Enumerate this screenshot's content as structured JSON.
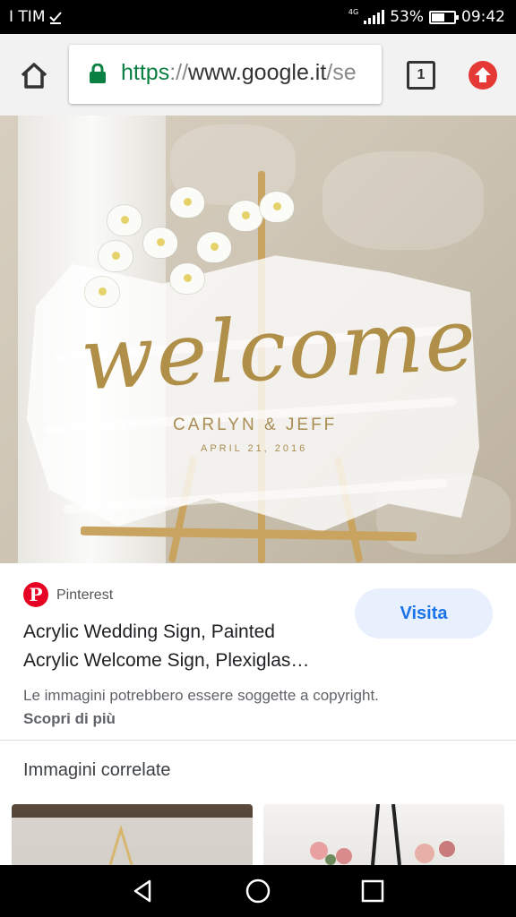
{
  "status_bar": {
    "carrier": "I TIM",
    "network": "4G",
    "battery": "53%",
    "time": "09:42"
  },
  "browser": {
    "url_scheme": "https",
    "url_separator": "://",
    "url_host": "www.google.it",
    "url_rest": "/se",
    "tab_count": "1"
  },
  "hero_image": {
    "sign_text": "welcome",
    "names": "CARLYN & JEFF",
    "date": "APRIL 21, 2016"
  },
  "result": {
    "source": "Pinterest",
    "title_line1": "Acrylic Wedding Sign, Painted",
    "title_line2": "Acrylic Welcome Sign, Plexiglas…",
    "visit_label": "Visita",
    "copyright_text": "Le immagini potrebbero essere soggette a copyright.",
    "learn_more": "Scopri di più"
  },
  "related": {
    "title": "Immagini correlate"
  },
  "colors": {
    "accent": "#1a73e8",
    "pinterest": "#e60023",
    "secure": "#0b8043"
  }
}
